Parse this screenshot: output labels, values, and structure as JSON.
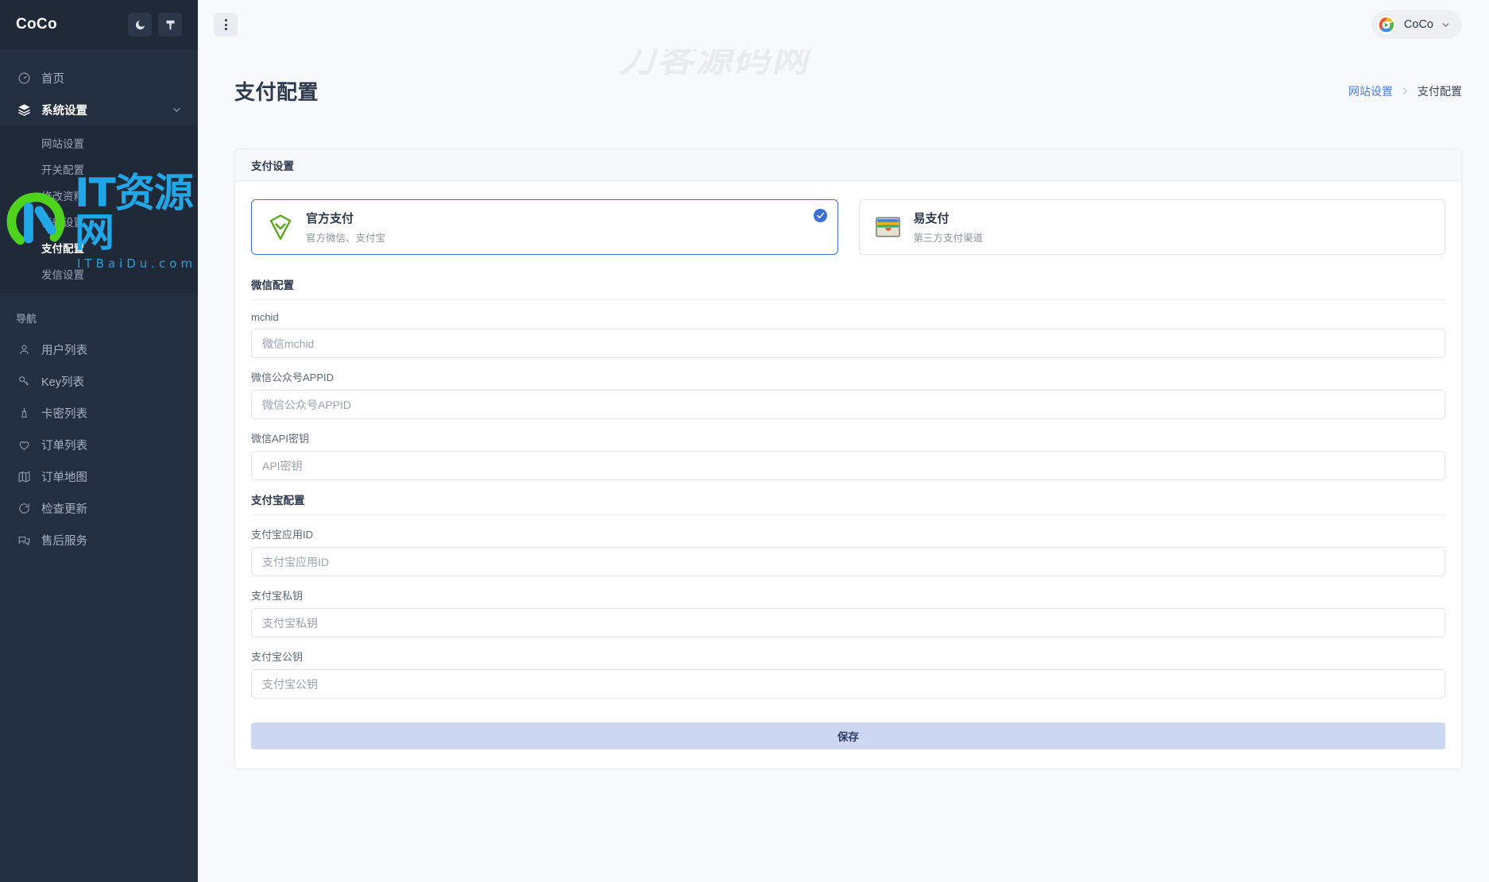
{
  "sidebar": {
    "brand": "CoCo",
    "brand_buttons": [
      {
        "name": "dark-mode-toggle",
        "icon": "moon-icon"
      },
      {
        "name": "theme-brush-button",
        "icon": "brush-icon"
      }
    ],
    "items": [
      {
        "label": "首页",
        "icon": "dashboard-icon",
        "active": false
      },
      {
        "label": "系统设置",
        "icon": "layers-icon",
        "active": true,
        "expandable": true
      }
    ],
    "submenu": [
      {
        "label": "网站设置",
        "active": false
      },
      {
        "label": "开关配置",
        "active": false
      },
      {
        "label": "修改资料",
        "active": false
      },
      {
        "label": "套餐设置",
        "active": false
      },
      {
        "label": "支付配置",
        "active": true
      },
      {
        "label": "发信设置",
        "active": false
      }
    ],
    "section_title": "导航",
    "nav_items": [
      {
        "label": "用户列表",
        "icon": "user-icon"
      },
      {
        "label": "Key列表",
        "icon": "key-icon"
      },
      {
        "label": "卡密列表",
        "icon": "card-icon"
      },
      {
        "label": "订单列表",
        "icon": "heart-icon"
      },
      {
        "label": "订单地图",
        "icon": "map-icon"
      },
      {
        "label": "检查更新",
        "icon": "refresh-icon"
      },
      {
        "label": "售后服务",
        "icon": "chat-icon"
      }
    ]
  },
  "topbar": {
    "kebab_name": "more-options-button",
    "user": {
      "name": "CoCo",
      "avatar": "coco-avatar"
    }
  },
  "page": {
    "title": "支付配置",
    "breadcrumb": {
      "parent": "网站设置",
      "current": "支付配置"
    }
  },
  "card": {
    "header": "支付设置",
    "pay_options": [
      {
        "title": "官方支付",
        "subtitle": "官方微信、支付宝",
        "icon": "shield-check-icon",
        "selected": true
      },
      {
        "title": "易支付",
        "subtitle": "第三方支付渠道",
        "icon": "wallet-card-icon",
        "selected": false
      }
    ],
    "sections": [
      {
        "title": "微信配置",
        "fields": [
          {
            "label": "mchid",
            "value": "",
            "placeholder": "微信mchid",
            "name": "wechat-mchid-input"
          },
          {
            "label": "微信公众号APPID",
            "value": "",
            "placeholder": "微信公众号APPID",
            "name": "wechat-appid-input"
          },
          {
            "label": "微信API密钥",
            "value": "",
            "placeholder": "API密钥",
            "name": "wechat-apikey-input"
          }
        ]
      },
      {
        "title": "支付宝配置",
        "fields": [
          {
            "label": "支付宝应用ID",
            "value": "",
            "placeholder": "支付宝应用ID",
            "name": "alipay-appid-input"
          },
          {
            "label": "支付宝私钥",
            "value": "",
            "placeholder": "支付宝私钥",
            "name": "alipay-privatekey-input"
          },
          {
            "label": "支付宝公钥",
            "value": "",
            "placeholder": "支付宝公钥",
            "name": "alipay-publickey-input"
          }
        ]
      }
    ],
    "save_label": "保存"
  },
  "watermarks": {
    "text": "刀客源码网",
    "logo_main": "IT资源网",
    "logo_sub": "ITBaiDu.com"
  },
  "colors": {
    "sidebar_bg": "#232e3e",
    "sidebar_sub_bg": "#1f2938",
    "accent": "#3b6fd4",
    "link": "#4a7dd8",
    "save_bg": "#ccd8f2",
    "page_bg": "#f8f9fb"
  }
}
